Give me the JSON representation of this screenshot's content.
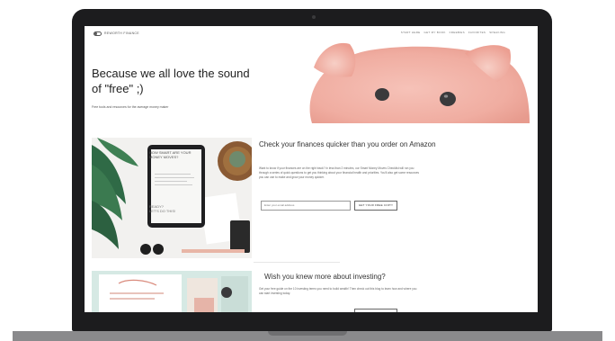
{
  "nav": {
    "logo_text": "REWORTH FINANCE",
    "items": [
      "Start here",
      "Get my book",
      "Freebies",
      "Favorites",
      "Speaking"
    ]
  },
  "hero": {
    "title_line1": "Because we all love the sound",
    "title_line2": "of \"free\" ;)",
    "subtitle": "Free tools and resources for the average money maker"
  },
  "checklist": {
    "title": "Check your finances quicker than you order on Amazon",
    "body": "Want to know if your finances are on the right track? In less than 2 minutes, our Smart Money Moves Checklist will run you through a series of quick questions to get you thinking about your financial health and priorities. You'll also get some resources you can use to make and grow your money quicker.",
    "email_placeholder": "Enter your email address",
    "button_label": "GET YOUR FREE COPY!",
    "tablet_heading": "HOW SMART ARE YOUR MONEY MOVES?",
    "tablet_footer_line1": "READY?",
    "tablet_footer_line2": "LET'S DO THIS!"
  },
  "investing": {
    "title": "Wish you knew more about investing?",
    "body": "Get your free guide on the 10 investing terms you need to build wealth! Then check out this blog to learn how and where you can start investing today."
  },
  "colors": {
    "pig_pink": "#f2b3a8",
    "nav_text": "#777777",
    "heading_text": "#222222",
    "laptop_frame": "#1c1c1e"
  }
}
